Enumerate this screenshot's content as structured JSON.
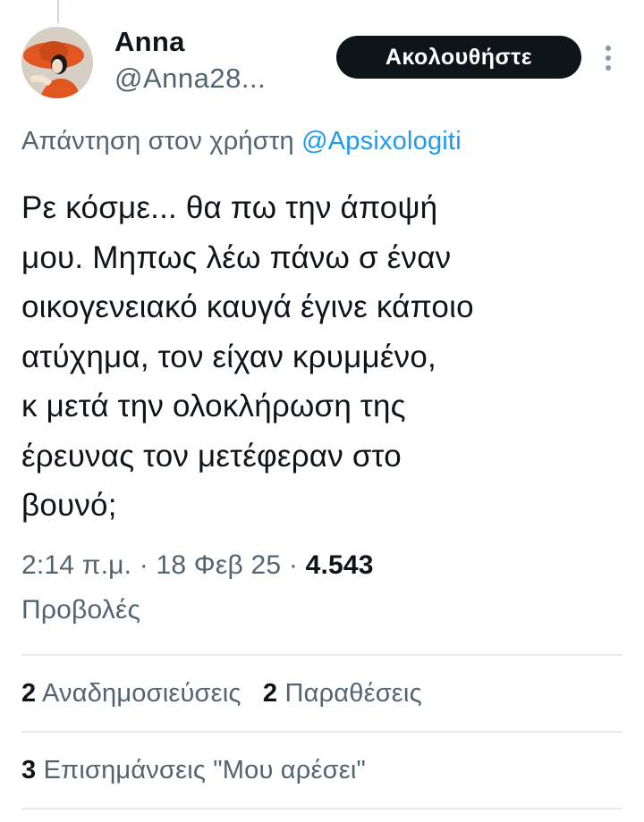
{
  "user": {
    "display_name": "Anna",
    "handle": "@Anna28..."
  },
  "follow_button_label": "Ακολουθήστε",
  "reply": {
    "prefix": "Απάντηση στον χρήστη",
    "mention": "@Apsixologiti"
  },
  "tweet": {
    "lines": [
      "Ρε κόσμε... θα πω την άποψή",
      "μου. Μηπως λέω πάνω σ έναν",
      "οικογενειακό καυγά έγινε κάποιο",
      "ατύχημα, τον είχαν κρυμμένο,",
      "κ μετά την ολοκλήρωση της",
      "έρευνας τον μετέφεραν στο",
      "βουνό;"
    ]
  },
  "meta": {
    "time": "2:14 π.μ.",
    "separator": "·",
    "date": "18 Φεβ 25",
    "views_count": "4.543",
    "views_label": "Προβολές"
  },
  "stats": {
    "reposts_count": "2",
    "reposts_label": "Αναδημοσιεύσεις",
    "quotes_count": "2",
    "quotes_label": "Παραθέσεις",
    "bookmarks_count": "3",
    "bookmarks_label": "Επισημάνσεις \"Μου αρέσει\""
  },
  "icons": {
    "more": "more-vertical-icon",
    "avatar": "profile-avatar"
  },
  "colors": {
    "text": "#0f1419",
    "secondary": "#536471",
    "link": "#1d9bf0",
    "button_bg": "#0f1419",
    "divider": "#e6ebee"
  }
}
